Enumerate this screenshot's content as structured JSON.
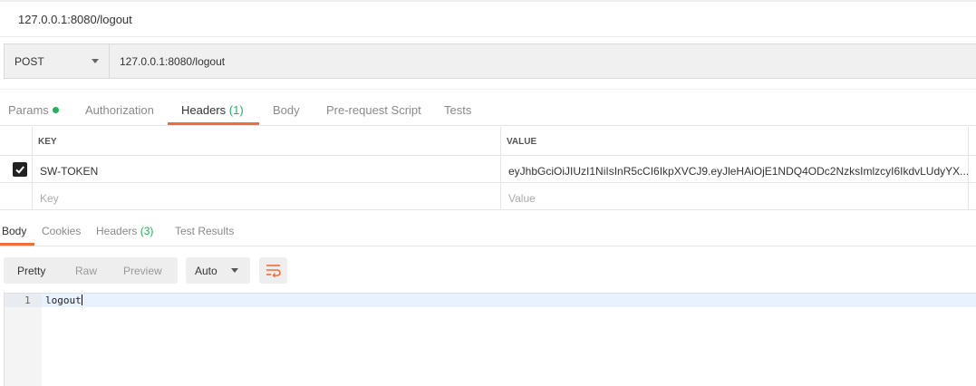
{
  "request": {
    "title": "127.0.0.1:8080/logout",
    "method": "POST",
    "url": "127.0.0.1:8080/logout"
  },
  "request_tabs": {
    "params": "Params",
    "authorization": "Authorization",
    "headers": "Headers",
    "headers_count": "(1)",
    "body": "Body",
    "prerequest": "Pre-request Script",
    "tests": "Tests"
  },
  "headers_table": {
    "columns": [
      "KEY",
      "VALUE"
    ],
    "rows": [
      {
        "checked": true,
        "key": "SW-TOKEN",
        "value": "eyJhbGciOiJIUzI1NiIsInR5cCI6IkpXVCJ9.eyJleHAiOjE1NDQ4ODc2NzksImlzcyI6IkdvLUdyYX..."
      }
    ],
    "new_key_placeholder": "Key",
    "new_value_placeholder": "Value"
  },
  "response_tabs": {
    "body": "Body",
    "cookies": "Cookies",
    "headers": "Headers",
    "headers_count": "(3)",
    "test_results": "Test Results"
  },
  "response_toolbar": {
    "pretty": "Pretty",
    "raw": "Raw",
    "preview": "Preview",
    "format": "Auto"
  },
  "response_body": {
    "line_number": "1",
    "content": "logout"
  },
  "colors": {
    "accent": "#f26b3a",
    "status_green": "#27ae60"
  },
  "icons": [
    "chevron-down-icon",
    "status-dot-icon",
    "checkbox-checked-icon",
    "wrap-lines-icon"
  ]
}
